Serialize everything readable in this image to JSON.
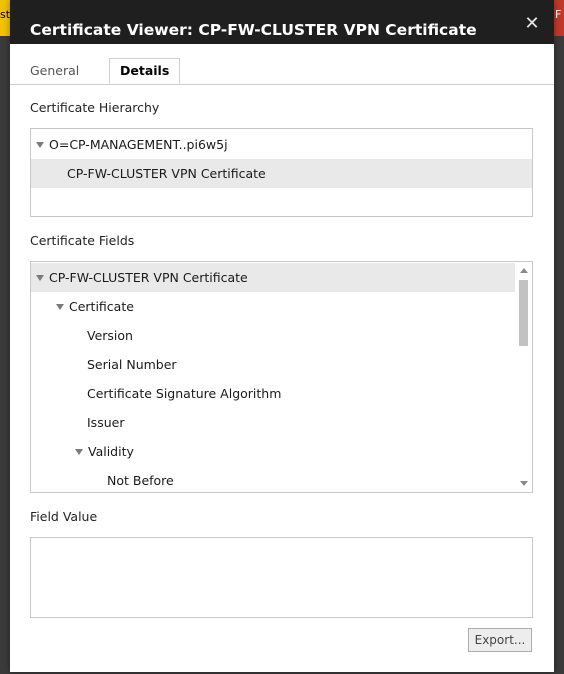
{
  "background": {
    "left_fragment": "st",
    "right_fragment": "F"
  },
  "dialog": {
    "title": "Certificate Viewer: CP-FW-CLUSTER VPN Certificate",
    "close_glyph": "✕"
  },
  "tabs": [
    {
      "label": "General",
      "active": false
    },
    {
      "label": "Details",
      "active": true
    }
  ],
  "hierarchy": {
    "label": "Certificate Hierarchy",
    "items": [
      {
        "label": "O=CP-MANAGEMENT..pi6w5j",
        "expanded": true,
        "depth": 0,
        "selected": false
      },
      {
        "label": "CP-FW-CLUSTER VPN Certificate",
        "expanded": null,
        "depth": 1,
        "selected": true
      }
    ]
  },
  "fields": {
    "label": "Certificate Fields",
    "items": [
      {
        "label": "CP-FW-CLUSTER VPN Certificate",
        "expanded": true,
        "depth": 0,
        "selected": true
      },
      {
        "label": "Certificate",
        "expanded": true,
        "depth": 1,
        "selected": false
      },
      {
        "label": "Version",
        "expanded": null,
        "depth": 2,
        "selected": false
      },
      {
        "label": "Serial Number",
        "expanded": null,
        "depth": 2,
        "selected": false
      },
      {
        "label": "Certificate Signature Algorithm",
        "expanded": null,
        "depth": 2,
        "selected": false
      },
      {
        "label": "Issuer",
        "expanded": null,
        "depth": 2,
        "selected": false
      },
      {
        "label": "Validity",
        "expanded": true,
        "depth": 2,
        "selected": false
      },
      {
        "label": "Not Before",
        "expanded": null,
        "depth": 3,
        "selected": false
      }
    ]
  },
  "field_value": {
    "label": "Field Value",
    "value": ""
  },
  "export_button": {
    "label": "Export..."
  },
  "colors": {
    "titlebar_bg": "#1f1f1f",
    "selected_row_bg": "#e9e9e9",
    "border": "#c8c8c8"
  }
}
